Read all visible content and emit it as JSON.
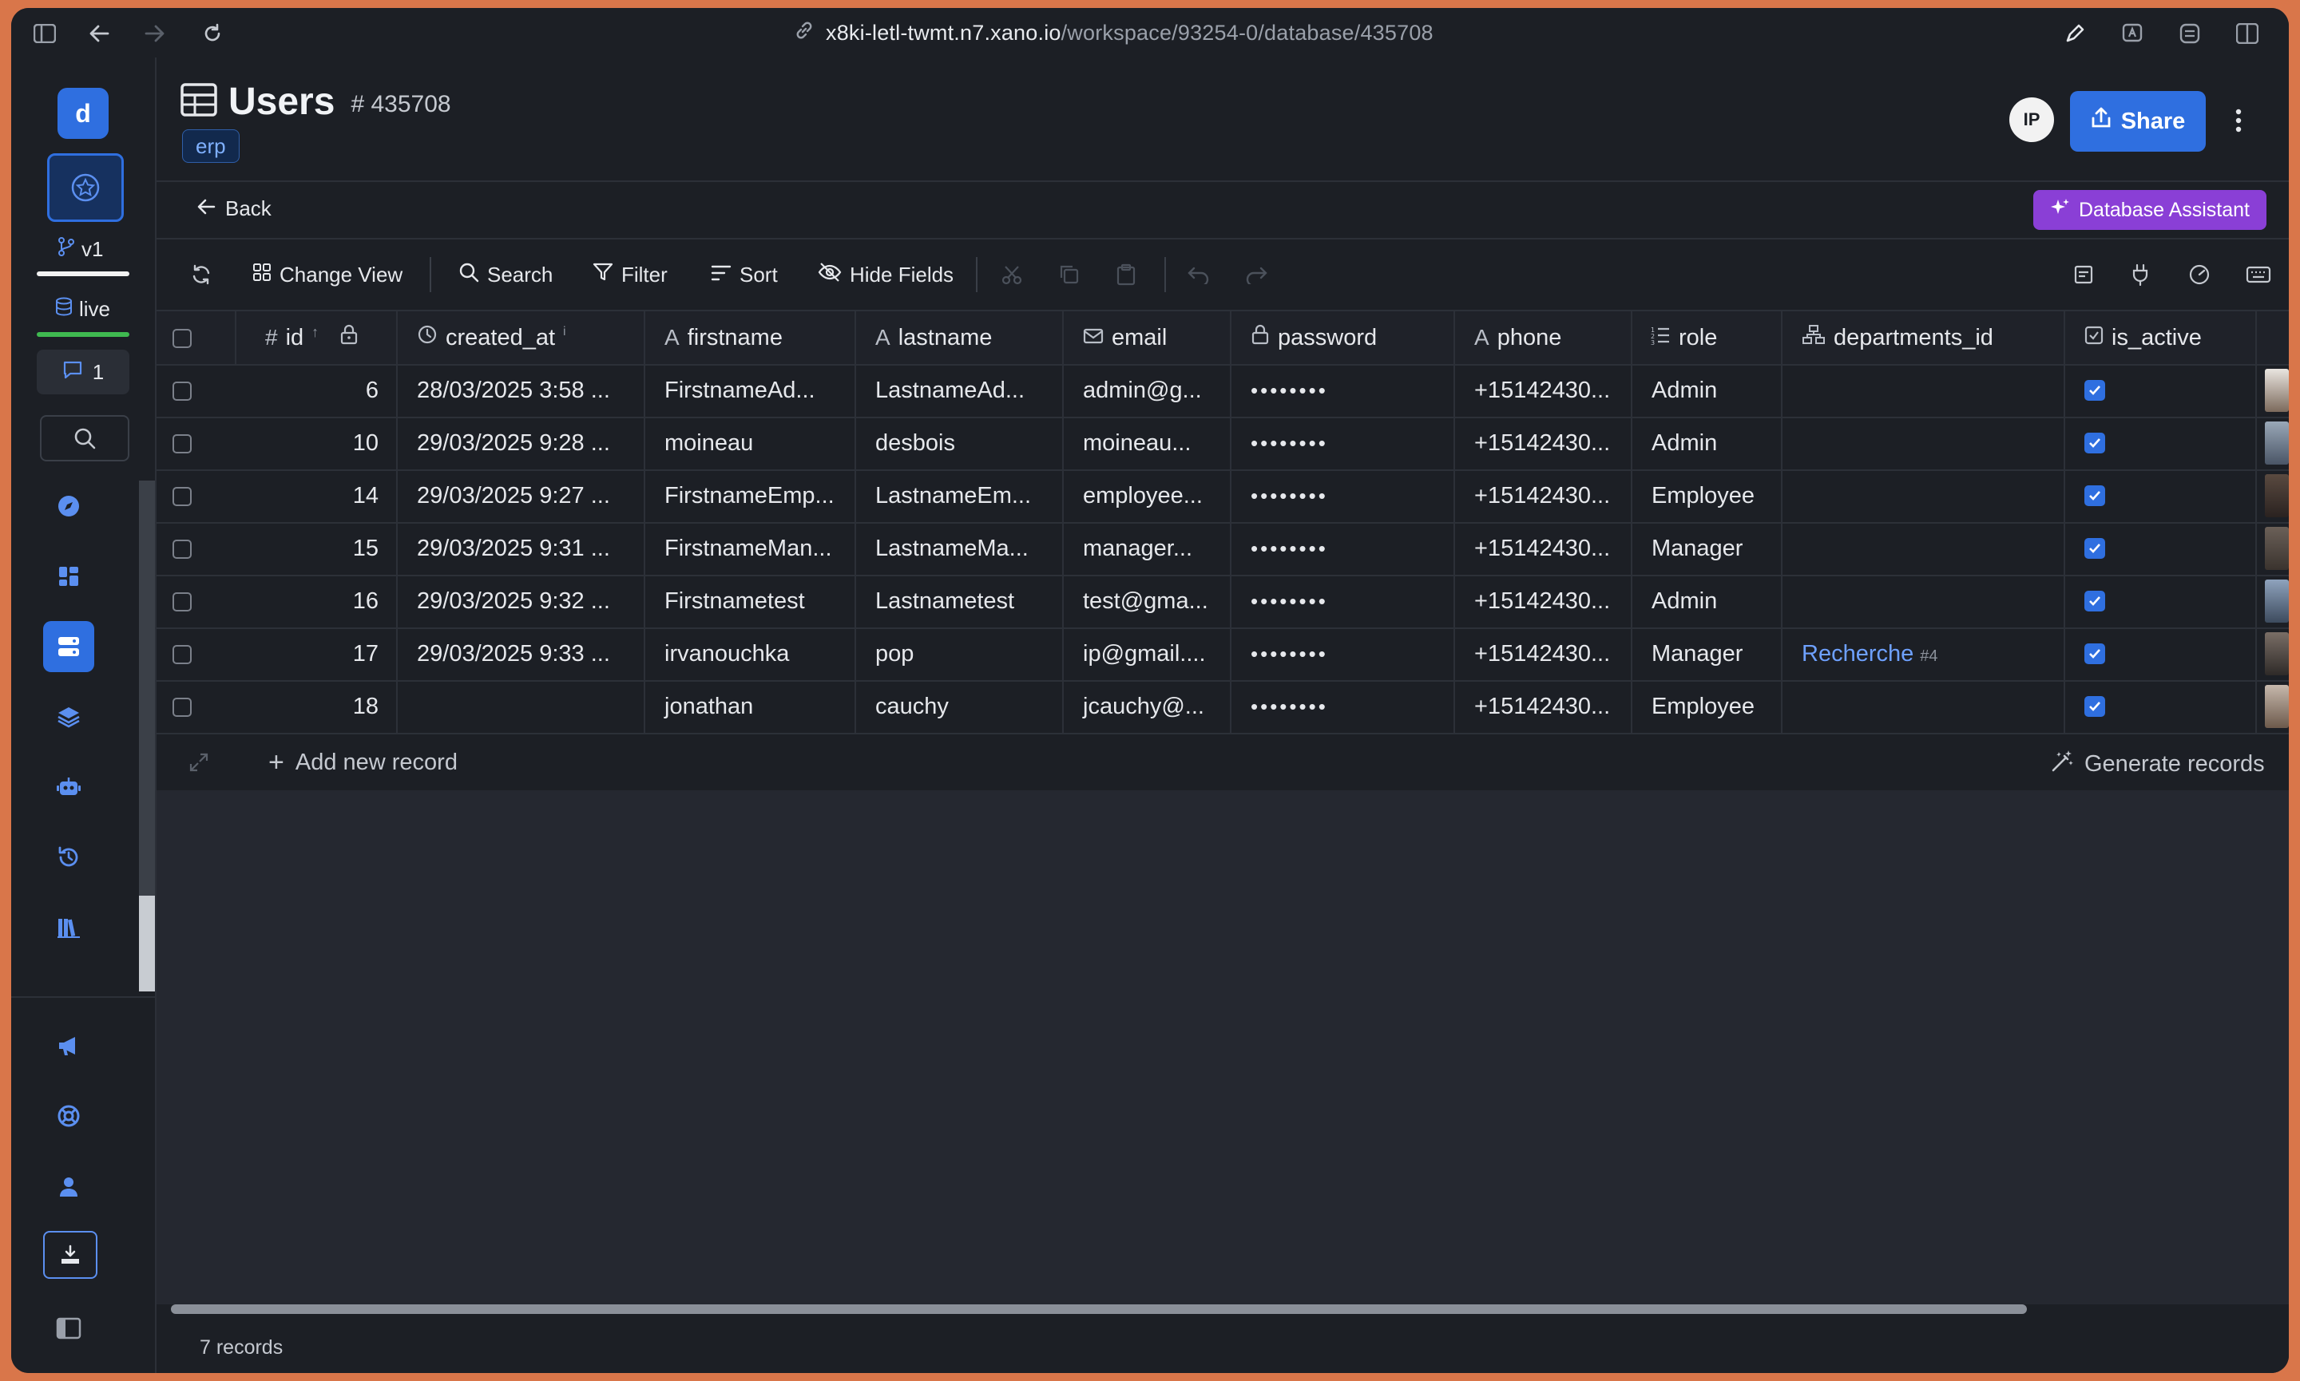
{
  "browser": {
    "url_host": "x8ki-letl-twmt.n7.xano.io",
    "url_path": "/workspace/93254-0/database/435708"
  },
  "rail": {
    "workspace_initial": "d",
    "branch": "v1",
    "environment": "live",
    "comment_count": "1"
  },
  "header": {
    "title": "Users",
    "table_id": "# 435708",
    "tag": "erp",
    "avatar_initials": "IP",
    "share_label": "Share",
    "back_label": "Back",
    "assistant_label": "Database Assistant"
  },
  "toolbar": {
    "change_view": "Change View",
    "search": "Search",
    "filter": "Filter",
    "sort": "Sort",
    "hide_fields": "Hide Fields"
  },
  "table": {
    "columns": [
      {
        "key": "id",
        "label": "id",
        "icon": "hash-icon"
      },
      {
        "key": "created_at",
        "label": "created_at",
        "icon": "clock-icon"
      },
      {
        "key": "firstname",
        "label": "firstname",
        "icon": "text-icon"
      },
      {
        "key": "lastname",
        "label": "lastname",
        "icon": "text-icon"
      },
      {
        "key": "email",
        "label": "email",
        "icon": "mail-icon"
      },
      {
        "key": "password",
        "label": "password",
        "icon": "lock-icon"
      },
      {
        "key": "phone",
        "label": "phone",
        "icon": "text-icon"
      },
      {
        "key": "role",
        "label": "role",
        "icon": "list-icon"
      },
      {
        "key": "departments_id",
        "label": "departments_id",
        "icon": "relation-icon"
      },
      {
        "key": "is_active",
        "label": "is_active",
        "icon": "checkbox-icon"
      }
    ],
    "rows": [
      {
        "id": "6",
        "created_at": "28/03/2025 3:58 ...",
        "firstname": "FirstnameAd...",
        "lastname": "LastnameAd...",
        "email": "admin@g...",
        "password": "••••••••",
        "phone": "+15142430...",
        "role": "Admin",
        "dept": "",
        "dept_ref": "",
        "is_active": true
      },
      {
        "id": "10",
        "created_at": "29/03/2025 9:28 ...",
        "firstname": "moineau",
        "lastname": "desbois",
        "email": "moineau...",
        "password": "••••••••",
        "phone": "+15142430...",
        "role": "Admin",
        "dept": "",
        "dept_ref": "",
        "is_active": true
      },
      {
        "id": "14",
        "created_at": "29/03/2025 9:27 ...",
        "firstname": "FirstnameEmp...",
        "lastname": "LastnameEm...",
        "email": "employee...",
        "password": "••••••••",
        "phone": "+15142430...",
        "role": "Employee",
        "dept": "",
        "dept_ref": "",
        "is_active": true
      },
      {
        "id": "15",
        "created_at": "29/03/2025 9:31 ...",
        "firstname": "FirstnameMan...",
        "lastname": "LastnameMa...",
        "email": "manager...",
        "password": "••••••••",
        "phone": "+15142430...",
        "role": "Manager",
        "dept": "",
        "dept_ref": "",
        "is_active": true
      },
      {
        "id": "16",
        "created_at": "29/03/2025 9:32 ...",
        "firstname": "Firstnametest",
        "lastname": "Lastnametest",
        "email": "test@gma...",
        "password": "••••••••",
        "phone": "+15142430...",
        "role": "Admin",
        "dept": "",
        "dept_ref": "",
        "is_active": true
      },
      {
        "id": "17",
        "created_at": "29/03/2025 9:33 ...",
        "firstname": "irvanouchka",
        "lastname": "pop",
        "email": "ip@gmail....",
        "password": "••••••••",
        "phone": "+15142430...",
        "role": "Manager",
        "dept": "Recherche",
        "dept_ref": "#4",
        "is_active": true
      },
      {
        "id": "18",
        "created_at": "",
        "firstname": "jonathan",
        "lastname": "cauchy",
        "email": "jcauchy@...",
        "password": "••••••••",
        "phone": "+15142430...",
        "role": "Employee",
        "dept": "",
        "dept_ref": "",
        "is_active": true
      }
    ],
    "add_new_label": "Add new record",
    "generate_label": "Generate records",
    "record_count": "7 records"
  },
  "colors": {
    "accent": "#2f6fe0",
    "assistant": "#8a3fd6",
    "background": "#1c1f25",
    "link": "#6ea1ff"
  }
}
